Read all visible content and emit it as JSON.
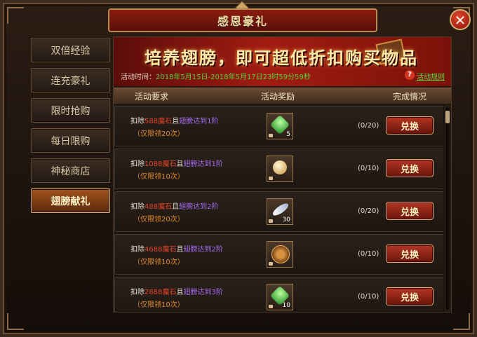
{
  "window": {
    "title": "感恩豪礼",
    "close_glyph": "✕"
  },
  "tabs": [
    {
      "label": "双倍经验",
      "active": false
    },
    {
      "label": "连充豪礼",
      "active": false
    },
    {
      "label": "限时抢购",
      "active": false
    },
    {
      "label": "每日限购",
      "active": false
    },
    {
      "label": "神秘商店",
      "active": false
    },
    {
      "label": "翅膀献礼",
      "active": true
    }
  ],
  "banner": {
    "headline": "培养翅膀，即可超低折扣购买物品",
    "time_label": "活动时间：",
    "time_value": "2018年5月15日-2018年5月17日23时59分59秒",
    "help_glyph": "?",
    "rules_link": "活动规则"
  },
  "columns": {
    "requirement": "活动要求",
    "reward": "活动奖励",
    "status": "完成情况"
  },
  "rows": [
    {
      "prefix": "扣除",
      "cost": "588魔石",
      "conj": "且",
      "cond": "翅膀达到1阶",
      "limit": "（仅限领20次）",
      "reward_icon": "green-gem-icon",
      "reward_color": "#3fd04a",
      "qty": "5",
      "progress": "(0/20)",
      "button": "兑换"
    },
    {
      "prefix": "扣除",
      "cost": "1088魔石",
      "conj": "且",
      "cond": "翅膀达到1阶",
      "limit": "（仅限领10次）",
      "reward_icon": "golden-orb-icon",
      "reward_color": "#e8c173",
      "qty": "",
      "progress": "(0/10)",
      "button": "兑换"
    },
    {
      "prefix": "扣除",
      "cost": "488魔石",
      "conj": "且",
      "cond": "翅膀达到2阶",
      "limit": "（仅限领20次）",
      "reward_icon": "feather-icon",
      "reward_color": "#e8ecf4",
      "qty": "30",
      "progress": "(0/20)",
      "button": "兑换"
    },
    {
      "prefix": "扣除",
      "cost": "4688魔石",
      "conj": "且",
      "cond": "翅膀达到2阶",
      "limit": "（仅限领10次）",
      "reward_icon": "bronze-disc-icon",
      "reward_color": "#b9752c",
      "qty": "",
      "progress": "(0/10)",
      "button": "兑换"
    },
    {
      "prefix": "扣除",
      "cost": "2888魔石",
      "conj": "且",
      "cond": "翅膀达到3阶",
      "limit": "（仅限领10次）",
      "reward_icon": "green-gem-icon",
      "reward_color": "#3fd04a",
      "qty": "10",
      "progress": "(0/10)",
      "button": "兑换"
    }
  ]
}
